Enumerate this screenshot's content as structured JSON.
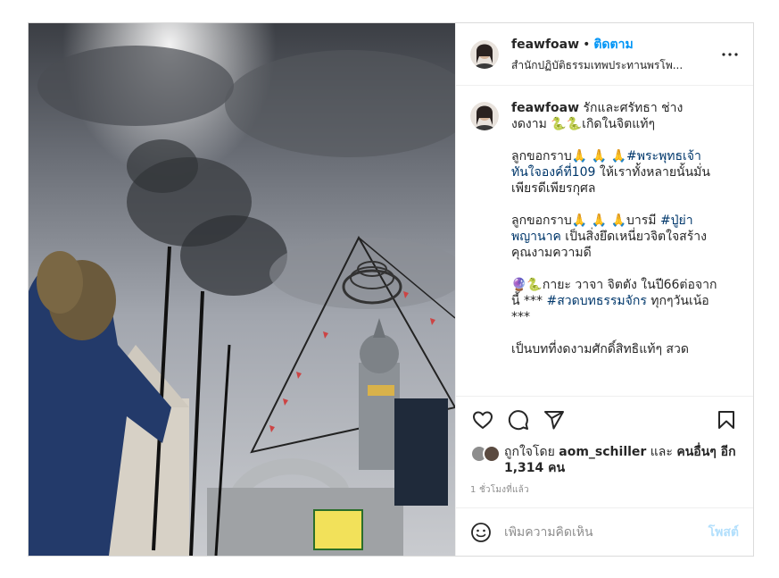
{
  "post": {
    "author": {
      "username": "feawfoaw",
      "follow_label": "ติดตาม",
      "separator": "•",
      "location": "สำนักปฏิบัติธรรมเทพประทานพรโพ..."
    },
    "caption": {
      "username": "feawfoaw",
      "paragraphs": [
        "รักและศรัทธา ช่างงดงาม 🐍🐍เกิดในจิตแท้ๆ",
        "ลูกขอกราบ🙏 🙏 🙏",
        "ลูกขอกราบ🙏 🙏 🙏บารมี",
        "🔮🐍กายะ วาจา จิตตัง ในปี66ต่อจากนี้ ***",
        "เป็นบทที่งดงามศักดิ์สิทธิแท้ๆ สวด"
      ],
      "hashtag1": "#พระพุทธเจ้าทันใจองค์ที่109",
      "text_after_tag1": " ให้เราทั้งหลายนั้นมั่นเพียรดีเพียรกุศล",
      "hashtag2": "#ปู่ย่าพญานาค",
      "text_after_tag2": " เป็นสิ่งยึดเหนี่ยวจิตใจสร้างคุณงามความดี",
      "hashtag3": "#สวดบทธรรมจักร",
      "text_after_tag3": " ทุกๆวันเน้อ ***"
    },
    "likes": {
      "prefix": "ถูกใจโดย ",
      "liker": "aom_schiller",
      "conjunction": " และ ",
      "others": "คนอื่นๆ อีก 1,314 คน"
    },
    "timestamp": "1 ชั่วโมงที่แล้ว",
    "comment": {
      "placeholder": "เพิ่มความคิดเห็น",
      "post_label": "โพสต์"
    },
    "icons": {
      "more": "more-options-icon",
      "like": "heart-icon",
      "comment": "comment-icon",
      "share": "paper-plane-icon",
      "save": "bookmark-icon",
      "emoji": "emoji-icon"
    },
    "colors": {
      "link_blue": "#0095f6",
      "hashtag": "#00376b",
      "muted": "#8e8e8e",
      "border": "#dbdbdb"
    }
  }
}
